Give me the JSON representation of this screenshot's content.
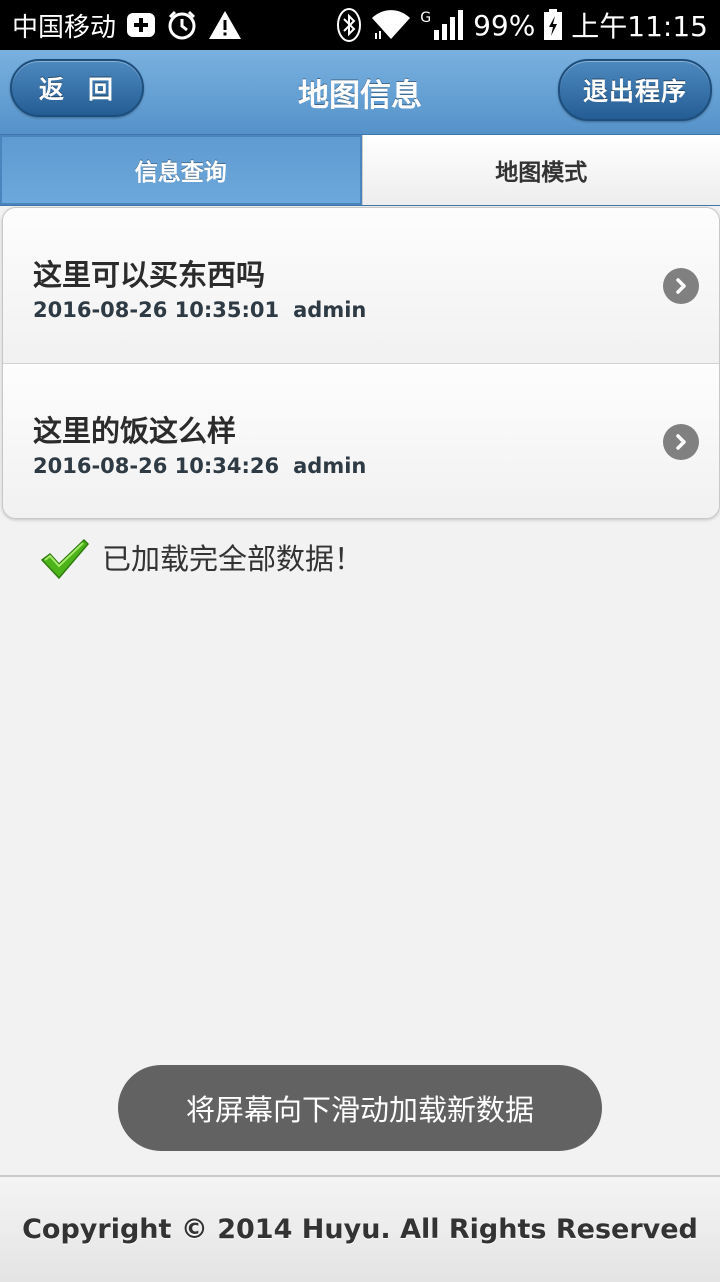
{
  "status_bar": {
    "carrier": "中国移动",
    "network_type": "G",
    "battery": "99%",
    "time": "上午11:15",
    "icons": [
      "add-box-icon",
      "alarm-icon",
      "warning-icon",
      "bluetooth-icon",
      "wifi-icon",
      "signal-icon",
      "battery-icon"
    ]
  },
  "header": {
    "back_label": "返回",
    "title": "地图信息",
    "exit_label": "退出程序"
  },
  "tabs": [
    {
      "label": "信息查询",
      "active": true
    },
    {
      "label": "地图模式",
      "active": false
    }
  ],
  "list": {
    "items": [
      {
        "title": "这里可以买东西吗",
        "datetime": "2016-08-26 10:35:01",
        "author": "admin"
      },
      {
        "title": "这里的饭这么样",
        "datetime": "2016-08-26 10:34:26",
        "author": "admin"
      }
    ]
  },
  "loaded_message": "已加载完全部数据！",
  "toast": "将屏幕向下滑动加载新数据",
  "footer": "Copyright © 2014 Huyu. All Rights Reserved",
  "colors": {
    "header_blue": "#5592c9",
    "button_blue": "#245d93",
    "check_green": "#4cb31b"
  }
}
